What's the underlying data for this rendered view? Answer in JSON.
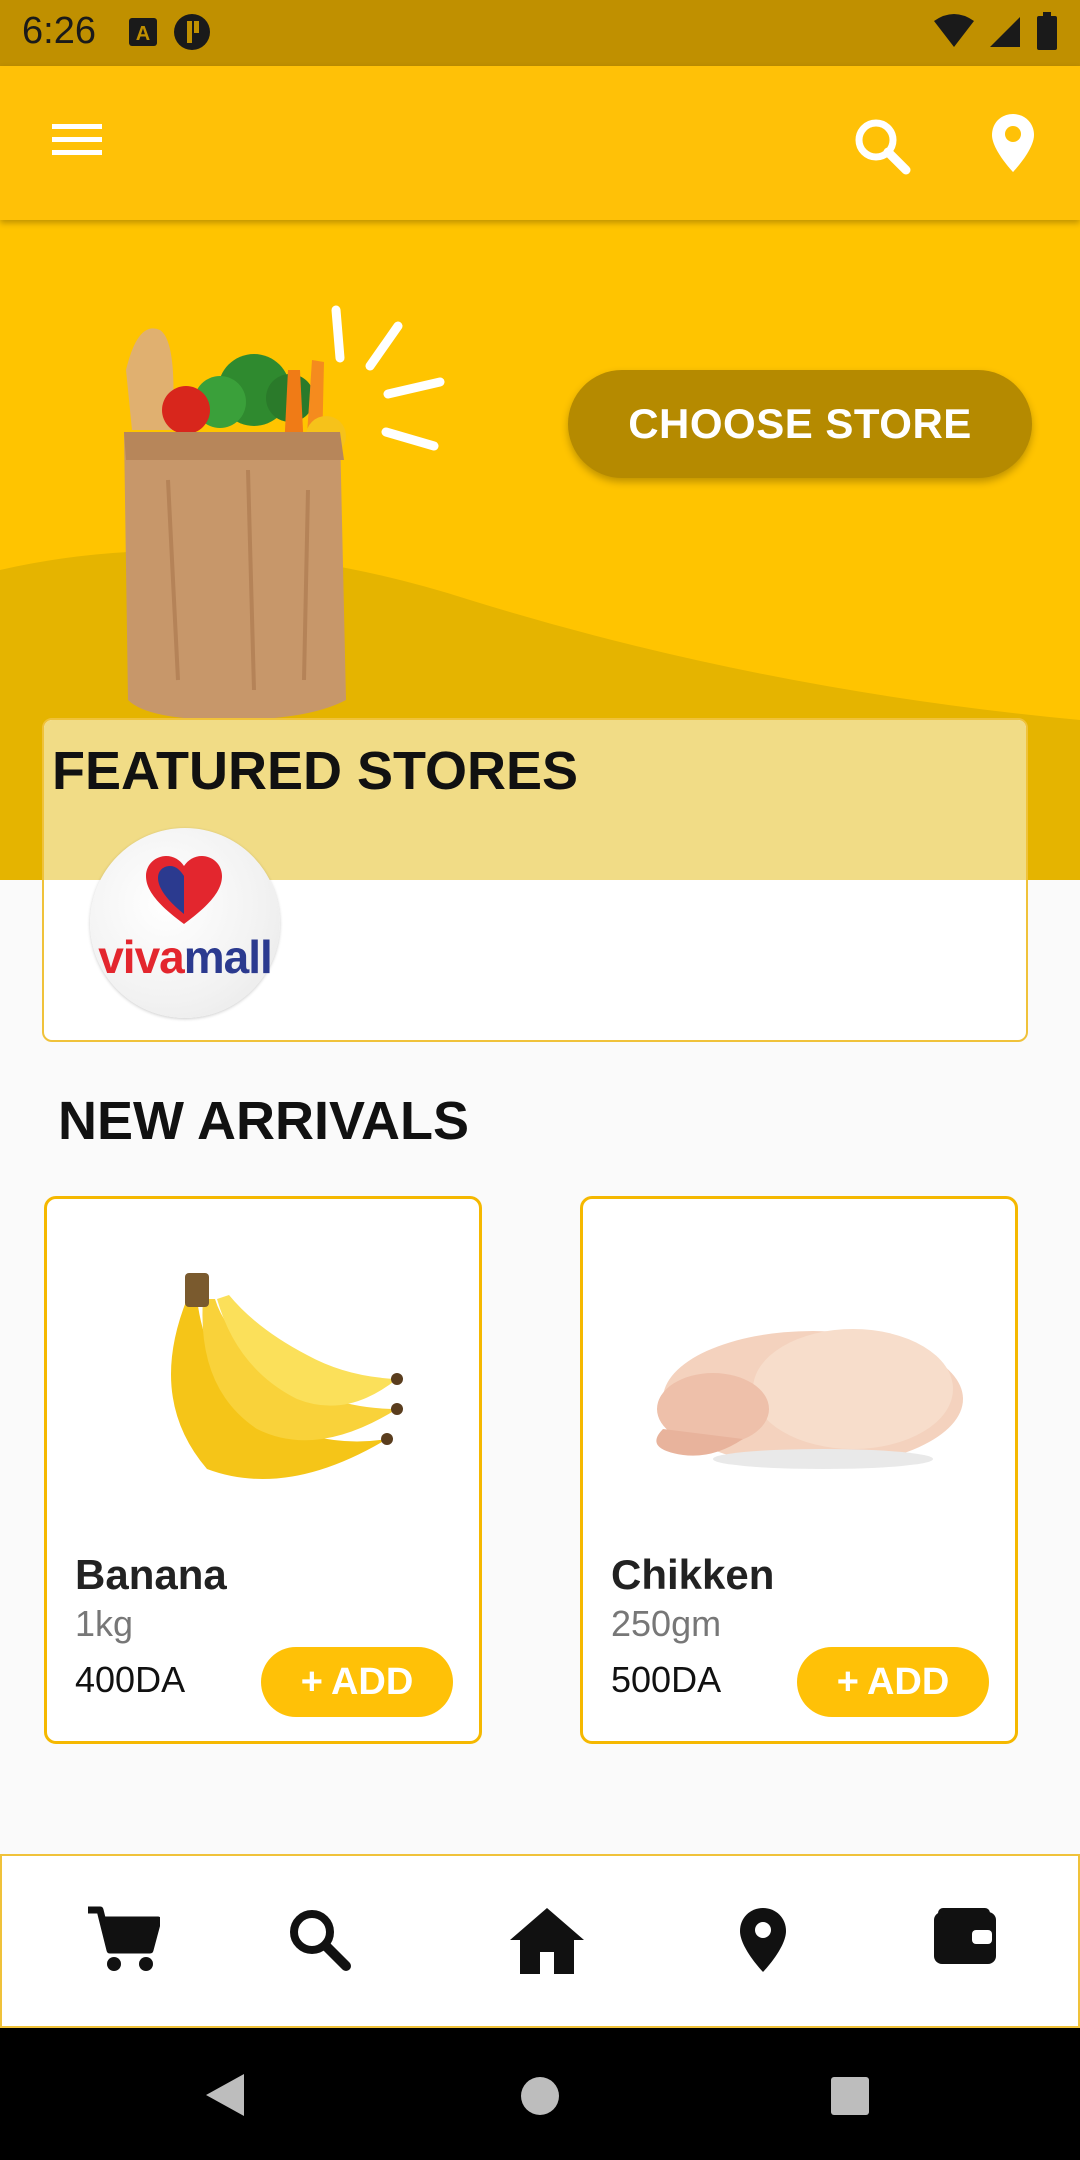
{
  "status_bar": {
    "time": "6:26",
    "left_icons": [
      "a-notification-icon",
      "p-notification-icon"
    ],
    "right_icons": [
      "wifi-icon",
      "signal-icon",
      "battery-icon"
    ]
  },
  "app_bar": {
    "menu_icon": "hamburger-icon",
    "search_icon": "search-icon",
    "location_icon": "location-pin-icon",
    "color": "#ffc107"
  },
  "hero": {
    "choose_store_label": "CHOOSE STORE",
    "image": "grocery-bag-illustration"
  },
  "featured": {
    "title": "FEATURED STORES",
    "stores": [
      {
        "logo_text_1": "viva",
        "logo_text_2": "mall"
      }
    ]
  },
  "new_arrivals": {
    "title": "NEW ARRIVALS",
    "products": [
      {
        "name": "Banana",
        "qty": "1kg",
        "price": "400DA",
        "add_label": "ADD",
        "image": "banana-image"
      },
      {
        "name": "Chikken",
        "qty": "250gm",
        "price": "500DA",
        "add_label": "ADD",
        "image": "chicken-image"
      }
    ]
  },
  "bottom_nav": {
    "items": [
      "cart-icon",
      "search-icon",
      "home-icon",
      "location-pin-icon",
      "wallet-icon"
    ]
  },
  "system_nav": [
    "back-icon",
    "home-circle-icon",
    "recents-icon"
  ],
  "colors": {
    "accent": "#ffc107",
    "dark_accent": "#b58a00"
  }
}
